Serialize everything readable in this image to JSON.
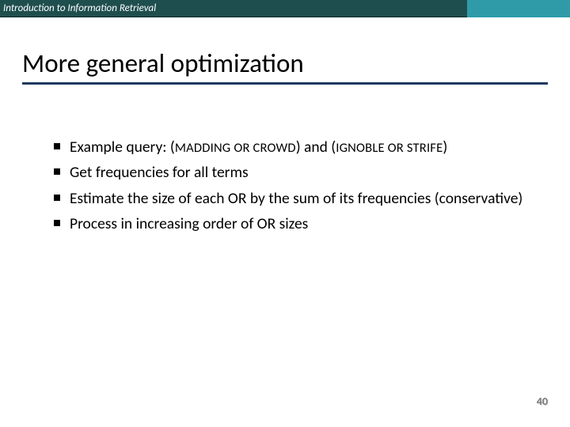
{
  "header": {
    "text": "Introduction to Information Retrieval"
  },
  "title": "More general optimization",
  "bullets": [
    {
      "pre": "Example query: (",
      "sc1": "MADDING OR CROWD",
      "mid": ") and (",
      "sc2": "IGNOBLE OR STRIFE",
      "post": ")"
    },
    {
      "text": "Get frequencies for all terms"
    },
    {
      "text": "Estimate the size of each OR by the sum of its frequencies (conservative)"
    },
    {
      "text": "Process in increasing order of OR sizes"
    }
  ],
  "page_number": "40"
}
